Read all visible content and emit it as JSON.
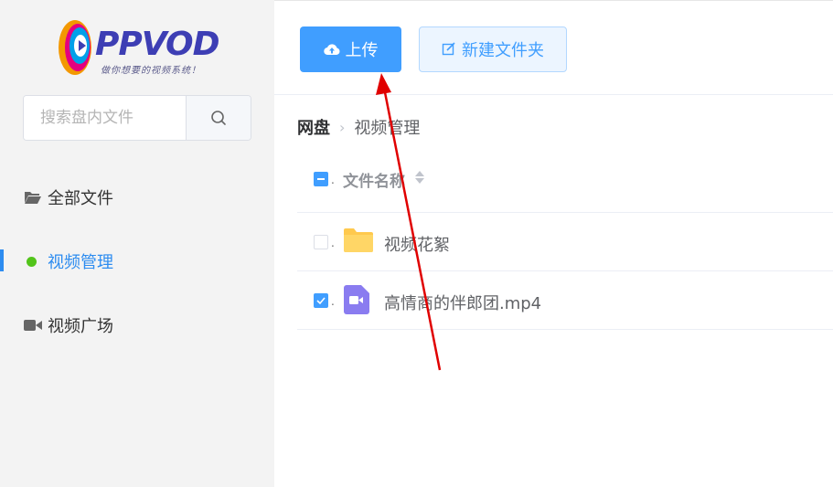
{
  "logo": {
    "text": "PPVOD",
    "slogan": "做你想要的视频系统！"
  },
  "search": {
    "placeholder": "搜索盘内文件"
  },
  "sidebar": {
    "items": [
      {
        "label": "全部文件",
        "icon": "folder-open-icon"
      },
      {
        "label": "视频管理",
        "icon": "dot-icon",
        "active": true
      },
      {
        "label": "视频广场",
        "icon": "video-camera-icon"
      }
    ]
  },
  "toolbar": {
    "upload_label": "上传",
    "new_folder_label": "新建文件夹"
  },
  "breadcrumb": {
    "root": "网盘",
    "current": "视频管理"
  },
  "table": {
    "header": {
      "name": "文件名称"
    },
    "rows": [
      {
        "name": "视频花絮",
        "type": "folder",
        "checked": false
      },
      {
        "name": "高情商的伴郎团.mp4",
        "type": "video",
        "checked": true
      }
    ]
  },
  "colors": {
    "primary": "#409eff",
    "annotation_arrow": "#e00000",
    "active_dot": "#52c41a"
  }
}
